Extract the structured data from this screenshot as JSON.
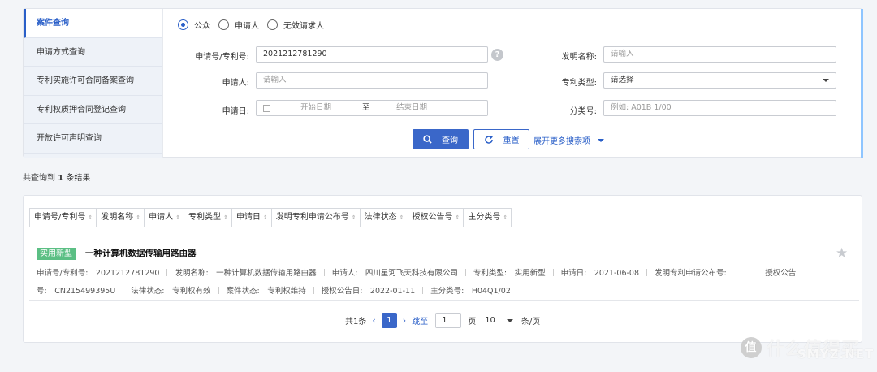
{
  "sidebar": {
    "items": [
      {
        "label": "案件查询"
      },
      {
        "label": "申请方式查询"
      },
      {
        "label": "专利实施许可合同备案查询"
      },
      {
        "label": "专利权质押合同登记查询"
      },
      {
        "label": "开放许可声明查询"
      }
    ]
  },
  "search": {
    "radios": [
      "公众",
      "申请人",
      "无效请求人"
    ],
    "selected_radio": "公众",
    "app_no_label": "申请号/专利号:",
    "app_no_value": "2021212781290",
    "help_icon": "?",
    "invention_name_label": "发明名称:",
    "invention_name_placeholder": "请输入",
    "applicant_label": "申请人:",
    "applicant_placeholder": "请输入",
    "patent_type_label": "专利类型:",
    "patent_type_value": "请选择",
    "apply_date_label": "申请日:",
    "start_date_placeholder": "开始日期",
    "date_separator": "至",
    "end_date_placeholder": "结束日期",
    "class_no_label": "分类号:",
    "class_no_placeholder": "例如: A01B 1/00",
    "query_button": "查询",
    "reset_button": "重置",
    "expand_link": "展开更多搜索项"
  },
  "results": {
    "count_prefix": "共查询到",
    "count": "1",
    "count_suffix": "条结果",
    "sort_columns": [
      "申请号/专利号",
      "发明名称",
      "申请人",
      "专利类型",
      "申请日",
      "发明专利申请公布号",
      "法律状态",
      "授权公告号",
      "主分类号"
    ],
    "records": [
      {
        "type_badge": "实用新型",
        "title": "一种计算机数据传输用路由器",
        "line1": [
          "申请号/专利号:　2021212781290",
          "发明名称:　一种计算机数据传输用路由器",
          "申请人:　四川星河飞天科技有限公司",
          "专利类型:　实用新型",
          "申请日:　2021-06-08",
          "发明专利申请公布号:　　　　　授权公告"
        ],
        "line2": [
          "号:　CN215499395U",
          "法律状态:　专利权有效",
          "案件状态:　专利权维持",
          "授权公告日:　2022-01-11",
          "主分类号:　H04Q1/02"
        ]
      }
    ]
  },
  "pager": {
    "total": "共1条",
    "current_page": "1",
    "jump_label": "跳至",
    "jump_value": "1",
    "page_unit": "页",
    "page_size": "10",
    "per_page_unit": "条/页"
  },
  "watermark": {
    "logo_char": "值",
    "text": "什么值得买",
    "site": "SMYZ.NET"
  },
  "colors": {
    "primary": "#3a67c9",
    "badge_green": "#5bbf84",
    "sidebar_bg": "#eef2f8",
    "page_bg": "#f3f5f8"
  }
}
